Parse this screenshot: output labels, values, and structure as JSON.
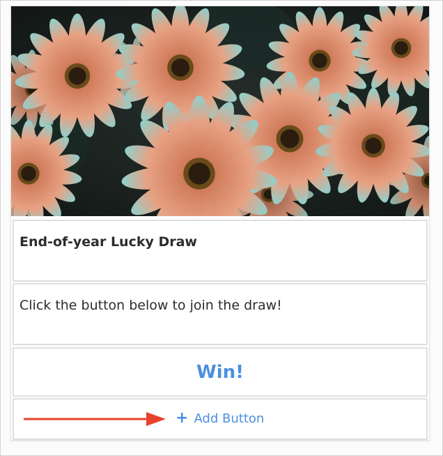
{
  "card": {
    "hero_image": {
      "icon": "flower-photo",
      "description_colors": [
        "#1d2624",
        "#d98a6a",
        "#e7a284",
        "#8fd3d3",
        "#3a2a1a"
      ]
    },
    "title": "End-of-year Lucky Draw",
    "description": "Click the button below to join the draw!",
    "win_button_label": "Win!",
    "add_button": {
      "icon": "plus-icon",
      "label": "Add Button"
    }
  },
  "annotation": {
    "arrow_color": "#e8412c"
  },
  "colors": {
    "accent": "#4a90e2",
    "border": "#dedede",
    "text": "#2c2c2c"
  }
}
